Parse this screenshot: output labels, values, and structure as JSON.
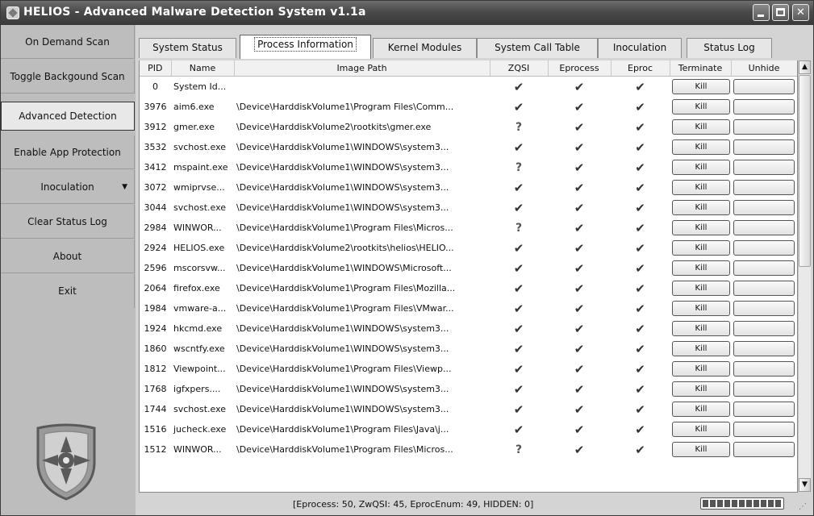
{
  "window": {
    "title": "HELIOS - Advanced Malware Detection System v1.1a"
  },
  "sidebar": {
    "items": [
      {
        "label": "On Demand Scan"
      },
      {
        "label": "Toggle Backgound Scan"
      },
      {
        "label": "Advanced Detection",
        "active": true
      },
      {
        "label": "Enable App Protection"
      },
      {
        "label": "Inoculation",
        "dropdown": true
      },
      {
        "label": "Clear Status Log"
      },
      {
        "label": "About"
      },
      {
        "label": "Exit"
      }
    ],
    "logo": "helios-shield-logo"
  },
  "tabs": [
    {
      "label": "System Status"
    },
    {
      "label": "Process Information",
      "active": true
    },
    {
      "label": "Kernel Modules"
    },
    {
      "label": "System Call Table"
    },
    {
      "label": "Inoculation"
    },
    {
      "label": "Status Log"
    }
  ],
  "table": {
    "columns": [
      "PID",
      "Name",
      "Image Path",
      "ZQSI",
      "Eprocess",
      "Eproc",
      "Terminate",
      "Unhide"
    ],
    "kill_label": "Kill",
    "rows": [
      {
        "pid": "0",
        "name": "System Id...",
        "path": "",
        "zqsi": "✔",
        "eprocess": "✔",
        "eproc": "✔"
      },
      {
        "pid": "3976",
        "name": "aim6.exe",
        "path": "\\Device\\HarddiskVolume1\\Program Files\\Comm...",
        "zqsi": "✔",
        "eprocess": "✔",
        "eproc": "✔"
      },
      {
        "pid": "3912",
        "name": "gmer.exe",
        "path": "\\Device\\HarddiskVolume2\\rootkits\\gmer.exe",
        "zqsi": "?",
        "eprocess": "✔",
        "eproc": "✔"
      },
      {
        "pid": "3532",
        "name": "svchost.exe",
        "path": "\\Device\\HarddiskVolume1\\WINDOWS\\system3...",
        "zqsi": "✔",
        "eprocess": "✔",
        "eproc": "✔"
      },
      {
        "pid": "3412",
        "name": "mspaint.exe",
        "path": "\\Device\\HarddiskVolume1\\WINDOWS\\system3...",
        "zqsi": "?",
        "eprocess": "✔",
        "eproc": "✔"
      },
      {
        "pid": "3072",
        "name": "wmiprvse...",
        "path": "\\Device\\HarddiskVolume1\\WINDOWS\\system3...",
        "zqsi": "✔",
        "eprocess": "✔",
        "eproc": "✔"
      },
      {
        "pid": "3044",
        "name": "svchost.exe",
        "path": "\\Device\\HarddiskVolume1\\WINDOWS\\system3...",
        "zqsi": "✔",
        "eprocess": "✔",
        "eproc": "✔"
      },
      {
        "pid": "2984",
        "name": "WINWOR...",
        "path": "\\Device\\HarddiskVolume1\\Program Files\\Micros...",
        "zqsi": "?",
        "eprocess": "✔",
        "eproc": "✔"
      },
      {
        "pid": "2924",
        "name": "HELIOS.exe",
        "path": "\\Device\\HarddiskVolume2\\rootkits\\helios\\HELIO...",
        "zqsi": "✔",
        "eprocess": "✔",
        "eproc": "✔"
      },
      {
        "pid": "2596",
        "name": "mscorsvw...",
        "path": "\\Device\\HarddiskVolume1\\WINDOWS\\Microsoft...",
        "zqsi": "✔",
        "eprocess": "✔",
        "eproc": "✔"
      },
      {
        "pid": "2064",
        "name": "firefox.exe",
        "path": "\\Device\\HarddiskVolume1\\Program Files\\Mozilla...",
        "zqsi": "✔",
        "eprocess": "✔",
        "eproc": "✔"
      },
      {
        "pid": "1984",
        "name": "vmware-a...",
        "path": "\\Device\\HarddiskVolume1\\Program Files\\VMwar...",
        "zqsi": "✔",
        "eprocess": "✔",
        "eproc": "✔"
      },
      {
        "pid": "1924",
        "name": "hkcmd.exe",
        "path": "\\Device\\HarddiskVolume1\\WINDOWS\\system3...",
        "zqsi": "✔",
        "eprocess": "✔",
        "eproc": "✔"
      },
      {
        "pid": "1860",
        "name": "wscntfy.exe",
        "path": "\\Device\\HarddiskVolume1\\WINDOWS\\system3...",
        "zqsi": "✔",
        "eprocess": "✔",
        "eproc": "✔"
      },
      {
        "pid": "1812",
        "name": "Viewpoint...",
        "path": "\\Device\\HarddiskVolume1\\Program Files\\Viewp...",
        "zqsi": "✔",
        "eprocess": "✔",
        "eproc": "✔"
      },
      {
        "pid": "1768",
        "name": "igfxpers....",
        "path": "\\Device\\HarddiskVolume1\\WINDOWS\\system3...",
        "zqsi": "✔",
        "eprocess": "✔",
        "eproc": "✔"
      },
      {
        "pid": "1744",
        "name": "svchost.exe",
        "path": "\\Device\\HarddiskVolume1\\WINDOWS\\system3...",
        "zqsi": "✔",
        "eprocess": "✔",
        "eproc": "✔"
      },
      {
        "pid": "1516",
        "name": "jucheck.exe",
        "path": "\\Device\\HarddiskVolume1\\Program Files\\Java\\j...",
        "zqsi": "✔",
        "eprocess": "✔",
        "eproc": "✔"
      },
      {
        "pid": "1512",
        "name": "WINWOR...",
        "path": "\\Device\\HarddiskVolume1\\Program Files\\Micros...",
        "zqsi": "?",
        "eprocess": "✔",
        "eproc": "✔"
      }
    ]
  },
  "status": {
    "text": "[Eprocess: 50, ZwQSI: 45, EprocEnum: 49, HIDDEN: 0]",
    "progress": 1.0
  }
}
